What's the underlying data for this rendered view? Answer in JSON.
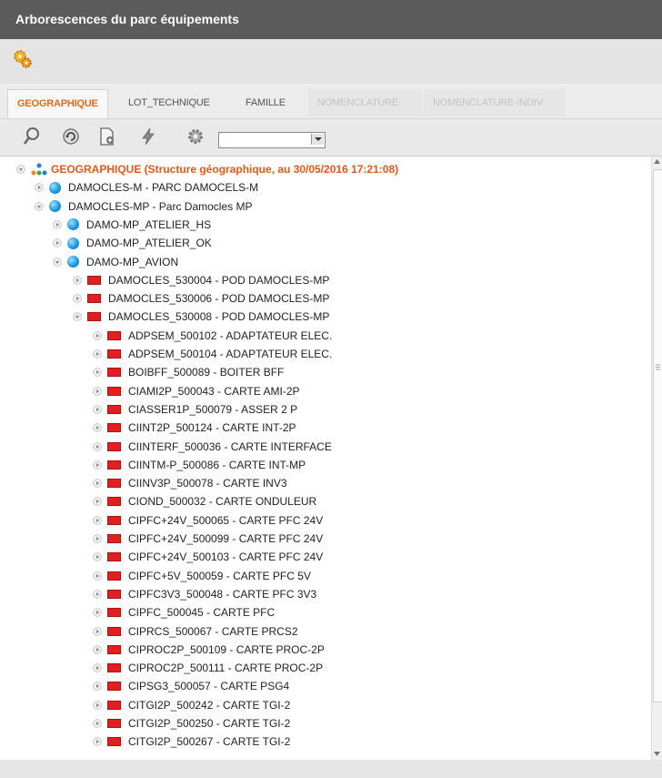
{
  "window": {
    "title": "Arborescences du parc équipements"
  },
  "tabs": [
    {
      "label": "GEOGRAPHIQUE",
      "state": "active"
    },
    {
      "label": "LOT_TECHNIQUE",
      "state": "normal"
    },
    {
      "label": "FAMILLE",
      "state": "normal"
    },
    {
      "label": "NOMENCLATURE",
      "state": "disabled"
    },
    {
      "label": "NOMENCLATURE-INDIV",
      "state": "disabled"
    }
  ],
  "toolbar": {
    "icons": [
      "search-icon",
      "refresh-icon",
      "new-document-icon",
      "lightning-icon",
      "settings-icon"
    ],
    "combo_value": ""
  },
  "colors": {
    "accent": "#e0581a",
    "title_bg": "#5b5b5b",
    "node_blue": "#1a9ae0",
    "node_red": "#e02020"
  },
  "tree": {
    "nodes": [
      {
        "label": "GEOGRAPHIQUE (Structure géographique, au 30/05/2016 17:21:08)",
        "expander": "open",
        "icon": "hierarchy-icon",
        "level": 0,
        "kind": "root"
      },
      {
        "label": "DAMOCLES-M - PARC DAMOCELS-M",
        "expander": "collapsed",
        "icon": "site-icon",
        "level": 1
      },
      {
        "label": "DAMOCLES-MP - Parc Damocles MP",
        "expander": "open",
        "icon": "site-icon",
        "level": 1
      },
      {
        "label": "DAMO-MP_ATELIER_HS",
        "expander": "collapsed",
        "icon": "site-icon",
        "level": 2
      },
      {
        "label": "DAMO-MP_ATELIER_OK",
        "expander": "collapsed",
        "icon": "site-icon",
        "level": 2
      },
      {
        "label": "DAMO-MP_AVION",
        "expander": "open",
        "icon": "site-icon",
        "level": 2
      },
      {
        "label": "DAMOCLES_530004 - POD DAMOCLES-MP",
        "expander": "collapsed",
        "icon": "equipment-icon",
        "level": 3
      },
      {
        "label": "DAMOCLES_530006 - POD DAMOCLES-MP",
        "expander": "collapsed",
        "icon": "equipment-icon",
        "level": 3
      },
      {
        "label": "DAMOCLES_530008 - POD DAMOCLES-MP",
        "expander": "open",
        "icon": "equipment-icon",
        "level": 3
      },
      {
        "label": "ADPSEM_500102 - ADAPTATEUR ELEC.",
        "expander": "collapsed",
        "icon": "equipment-icon",
        "level": 4
      },
      {
        "label": "ADPSEM_500104 - ADAPTATEUR ELEC.",
        "expander": "collapsed",
        "icon": "equipment-icon",
        "level": 4
      },
      {
        "label": "BOIBFF_500089 - BOITER BFF",
        "expander": "collapsed",
        "icon": "equipment-icon",
        "level": 4
      },
      {
        "label": "CIAMI2P_500043 - CARTE AMI-2P",
        "expander": "collapsed",
        "icon": "equipment-icon",
        "level": 4
      },
      {
        "label": "CIASSER1P_500079 - ASSER 2 P",
        "expander": "collapsed",
        "icon": "equipment-icon",
        "level": 4
      },
      {
        "label": "CIINT2P_500124 - CARTE INT-2P",
        "expander": "collapsed",
        "icon": "equipment-icon",
        "level": 4
      },
      {
        "label": "CIINTERF_500036 - CARTE INTERFACE",
        "expander": "collapsed",
        "icon": "equipment-icon",
        "level": 4
      },
      {
        "label": "CIINTM-P_500086 - CARTE INT-MP",
        "expander": "collapsed",
        "icon": "equipment-icon",
        "level": 4
      },
      {
        "label": "CIINV3P_500078 - CARTE INV3",
        "expander": "collapsed",
        "icon": "equipment-icon",
        "level": 4
      },
      {
        "label": "CIOND_500032 - CARTE ONDULEUR",
        "expander": "collapsed",
        "icon": "equipment-icon",
        "level": 4
      },
      {
        "label": "CIPFC+24V_500065 - CARTE PFC 24V",
        "expander": "collapsed",
        "icon": "equipment-icon",
        "level": 4
      },
      {
        "label": "CIPFC+24V_500099 - CARTE PFC 24V",
        "expander": "collapsed",
        "icon": "equipment-icon",
        "level": 4
      },
      {
        "label": "CIPFC+24V_500103 - CARTE PFC 24V",
        "expander": "collapsed",
        "icon": "equipment-icon",
        "level": 4
      },
      {
        "label": "CIPFC+5V_500059 - CARTE PFC 5V",
        "expander": "collapsed",
        "icon": "equipment-icon",
        "level": 4
      },
      {
        "label": "CIPFC3V3_500048 - CARTE PFC 3V3",
        "expander": "collapsed",
        "icon": "equipment-icon",
        "level": 4
      },
      {
        "label": "CIPFC_500045 - CARTE PFC",
        "expander": "collapsed",
        "icon": "equipment-icon",
        "level": 4
      },
      {
        "label": "CIPRCS_500067 - CARTE PRCS2",
        "expander": "collapsed",
        "icon": "equipment-icon",
        "level": 4
      },
      {
        "label": "CIPROC2P_500109 - CARTE PROC-2P",
        "expander": "collapsed",
        "icon": "equipment-icon",
        "level": 4
      },
      {
        "label": "CIPROC2P_500111 - CARTE PROC-2P",
        "expander": "collapsed",
        "icon": "equipment-icon",
        "level": 4
      },
      {
        "label": "CIPSG3_500057 - CARTE PSG4",
        "expander": "collapsed",
        "icon": "equipment-icon",
        "level": 4
      },
      {
        "label": "CITGI2P_500242 - CARTE TGI-2",
        "expander": "collapsed",
        "icon": "equipment-icon",
        "level": 4
      },
      {
        "label": "CITGI2P_500250 - CARTE TGI-2",
        "expander": "collapsed",
        "icon": "equipment-icon",
        "level": 4
      },
      {
        "label": "CITGI2P_500267 - CARTE TGI-2",
        "expander": "collapsed",
        "icon": "equipment-icon",
        "level": 4
      }
    ]
  }
}
